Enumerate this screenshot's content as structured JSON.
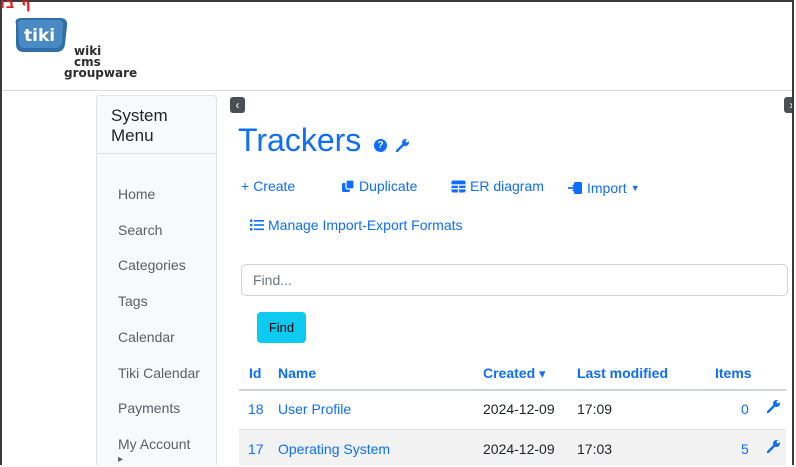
{
  "corner_mark": "ף בו",
  "logo": {
    "line1": "wiki",
    "line2": "cms",
    "line3": "groupware",
    "badge": "tiki"
  },
  "sidebar": {
    "title": "System Menu",
    "items": [
      {
        "label": "Home"
      },
      {
        "label": "Search"
      },
      {
        "label": "Categories"
      },
      {
        "label": "Tags"
      },
      {
        "label": "Calendar"
      },
      {
        "label": "Tiki Calendar"
      },
      {
        "label": "Payments"
      },
      {
        "label": "My Account"
      }
    ],
    "submenu_arrow": "▸"
  },
  "toggles": {
    "left": "‹",
    "right": "›"
  },
  "page": {
    "title": "Trackers",
    "help_icon": "?"
  },
  "actions": {
    "create": "Create",
    "duplicate": "Duplicate",
    "er_diagram": "ER diagram",
    "import": "Import",
    "manage_formats": "Manage Import-Export Formats"
  },
  "search": {
    "placeholder": "Find...",
    "button": "Find"
  },
  "table": {
    "headers": {
      "id": "Id",
      "name": "Name",
      "created": "Created",
      "last_modified": "Last modified",
      "items": "Items"
    },
    "sort_indicator": "▾",
    "rows": [
      {
        "id": "18",
        "name": "User Profile",
        "created": "2024-12-09",
        "modified": "17:09",
        "items": "0"
      },
      {
        "id": "17",
        "name": "Operating System",
        "created": "2024-12-09",
        "modified": "17:03",
        "items": "5"
      }
    ]
  },
  "colors": {
    "link": "#0d6efd",
    "find_button": "#0dcaf0"
  }
}
